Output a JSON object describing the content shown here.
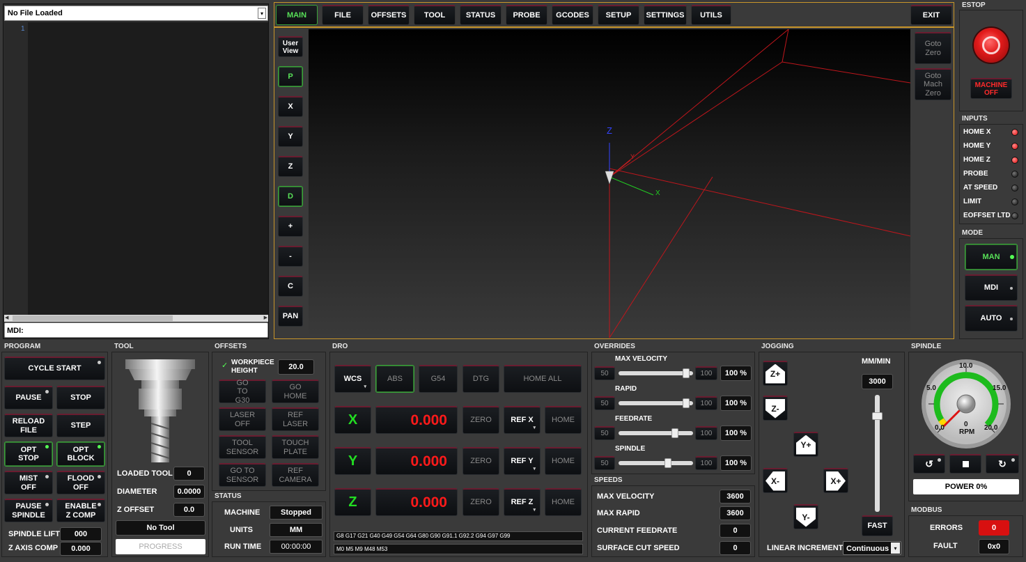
{
  "file": {
    "name": "No File Loaded",
    "line": "1",
    "mdi_label": "MDI:"
  },
  "tabs": [
    "MAIN",
    "FILE",
    "OFFSETS",
    "TOOL",
    "STATUS",
    "PROBE",
    "GCODES",
    "SETUP",
    "SETTINGS",
    "UTILS"
  ],
  "exit": "EXIT",
  "view": {
    "user_view": "User View",
    "buttons": [
      "P",
      "X",
      "Y",
      "Z",
      "D",
      "+",
      "-",
      "C",
      "PAN"
    ],
    "goto_zero": "Goto Zero",
    "goto_mach_zero": "Goto Mach Zero",
    "axis_x": "X",
    "axis_y": "Y",
    "axis_z": "Z"
  },
  "estop": {
    "title": "ESTOP",
    "machine": "MACHINE OFF"
  },
  "inputs": {
    "title": "INPUTS",
    "items": [
      {
        "label": "HOME X",
        "state": "red"
      },
      {
        "label": "HOME Y",
        "state": "red"
      },
      {
        "label": "HOME Z",
        "state": "red"
      },
      {
        "label": "PROBE",
        "state": "off"
      },
      {
        "label": "AT SPEED",
        "state": "off"
      },
      {
        "label": "LIMIT",
        "state": "off"
      },
      {
        "label": "EOFFSET LTD",
        "state": "off"
      }
    ]
  },
  "mode": {
    "title": "MODE",
    "items": [
      "MAN",
      "MDI",
      "AUTO"
    ]
  },
  "program": {
    "title": "PROGRAM",
    "cycle_start": "CYCLE START",
    "pause": "PAUSE",
    "stop": "STOP",
    "reload": "RELOAD FILE",
    "step": "STEP",
    "opt_stop": "OPT STOP",
    "opt_block": "OPT BLOCK",
    "mist": "MIST OFF",
    "flood": "FLOOD OFF",
    "pause_spindle": "PAUSE SPINDLE",
    "enable_z": "ENABLE Z COMP",
    "spindle_lift_label": "SPINDLE LIFT",
    "spindle_lift": "000",
    "z_axis_comp_label": "Z AXIS COMP",
    "z_axis_comp": "0.000"
  },
  "tool": {
    "title": "TOOL",
    "loaded_label": "LOADED TOOL",
    "loaded": "0",
    "diameter_label": "DIAMETER",
    "diameter": "0.0000",
    "zoffset_label": "Z OFFSET",
    "zoffset": "0.0",
    "name": "No Tool",
    "progress": "PROGRESS"
  },
  "offsets": {
    "title": "OFFSETS",
    "workpiece_label": "WORKPIECE HEIGHT",
    "workpiece": "20.0",
    "goto_g30": "GO TO G30",
    "go_home": "GO HOME",
    "laser_off": "LASER OFF",
    "ref_laser": "REF LASER",
    "tool_sensor": "TOOL SENSOR",
    "touch_plate": "TOUCH PLATE",
    "goto_sensor": "GO TO SENSOR",
    "ref_camera": "REF CAMERA"
  },
  "status": {
    "title": "STATUS",
    "machine_label": "MACHINE",
    "machine": "Stopped",
    "units_label": "UNITS",
    "units": "MM",
    "runtime_label": "RUN TIME",
    "runtime": "00:00:00"
  },
  "dro": {
    "title": "DRO",
    "wcs": "WCS",
    "abs": "ABS",
    "g54": "G54",
    "dtg": "DTG",
    "home_all": "HOME ALL",
    "zero": "ZERO",
    "home": "HOME",
    "axes": [
      {
        "axis": "X",
        "value": "0.000",
        "ref": "REF X"
      },
      {
        "axis": "Y",
        "value": "0.000",
        "ref": "REF Y"
      },
      {
        "axis": "Z",
        "value": "0.000",
        "ref": "REF Z"
      }
    ],
    "gcodes": "G8 G17 G21 G40 G49 G54 G64 G80 G90 G91.1 G92.2 G94 G97 G99",
    "mcodes": "M0 M5 M9 M48 M53"
  },
  "overrides": {
    "title": "OVERRIDES",
    "items": [
      {
        "label": "MAX VELOCITY",
        "min": "50",
        "max": "100",
        "value": "100 %",
        "level": 0.95
      },
      {
        "label": "RAPID",
        "min": "50",
        "max": "100",
        "value": "100 %",
        "level": 0.95
      },
      {
        "label": "FEEDRATE",
        "min": "50",
        "max": "100",
        "value": "100 %",
        "level": 0.78
      },
      {
        "label": "SPINDLE",
        "min": "50",
        "max": "100",
        "value": "100 %",
        "level": 0.68
      }
    ]
  },
  "speeds": {
    "title": "SPEEDS",
    "items": [
      {
        "label": "MAX VELOCITY",
        "value": "3600"
      },
      {
        "label": "MAX RAPID",
        "value": "3600"
      },
      {
        "label": "CURRENT FEEDRATE",
        "value": "0"
      },
      {
        "label": "SURFACE CUT SPEED",
        "value": "0"
      }
    ]
  },
  "jogging": {
    "title": "JOGGING",
    "units": "MM/MIN",
    "rate": "3000",
    "fast": "FAST",
    "linear_label": "LINEAR INCREMENT",
    "linear": "Continuous",
    "zplus": "Z+",
    "zminus": "Z-",
    "yplus": "Y+",
    "yminus": "Y-",
    "xplus": "X+",
    "xminus": "X-"
  },
  "spindle": {
    "title": "SPINDLE",
    "power": "POWER 0%",
    "rpm_label": "RPM",
    "rpm": "0",
    "dial": [
      "0.0",
      "5.0",
      "10.0",
      "15.0",
      "20.0"
    ]
  },
  "modbus": {
    "title": "MODBUS",
    "errors_label": "ERRORS",
    "errors": "0",
    "fault_label": "FAULT",
    "fault": "0x0"
  }
}
